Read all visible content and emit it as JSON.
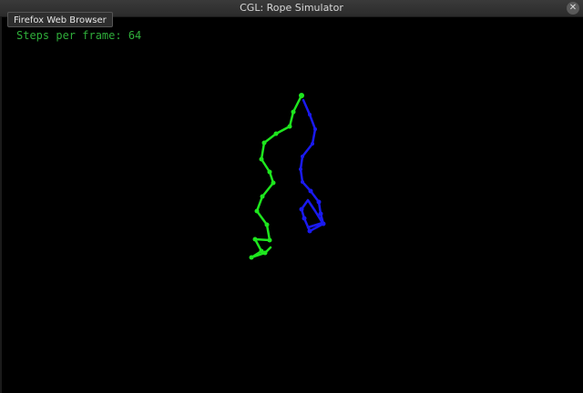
{
  "window": {
    "title": "CGL: Rope Simulator",
    "close_glyph": "✕"
  },
  "tooltip": {
    "label": "Firefox Web Browser"
  },
  "hud": {
    "steps_text": "Steps per frame: 64"
  },
  "colors": {
    "green_rope": "#1ee61e",
    "blue_rope": "#1a1af0",
    "hud_text": "#2fae3a"
  },
  "icons": {
    "close": "close-icon"
  }
}
